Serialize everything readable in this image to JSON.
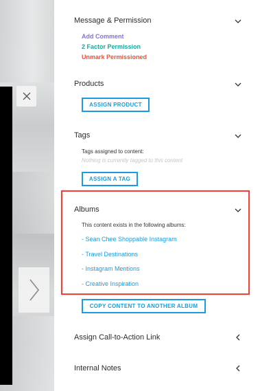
{
  "viewer": {
    "close_icon": "close-icon",
    "next_icon": "chevron-right-icon"
  },
  "sections": {
    "message_permission": {
      "title": "Message & Permission",
      "items": [
        {
          "label": "Add Comment",
          "color": "#8b6fe0"
        },
        {
          "label": "2 Factor Permission",
          "color": "#1ea79a"
        },
        {
          "label": "Unmark Permissioned",
          "color": "#e8563d"
        }
      ]
    },
    "products": {
      "title": "Products",
      "button": "ASSIGN PRODUCT"
    },
    "tags": {
      "title": "Tags",
      "caption": "Tags assigned to content:",
      "empty": "Nothing is currently tagged to this content",
      "button": "ASSIGN A TAG"
    },
    "albums": {
      "title": "Albums",
      "caption": "This content exists in the following albums:",
      "items": [
        "- Sean Chee Shoppable Instagram",
        "- Travel Destinations",
        "- Instagram Mentions",
        "- Creative Inspiration"
      ],
      "button": "COPY CONTENT TO ANOTHER ALBUM"
    },
    "cta": {
      "title": "Assign Call-to-Action Link"
    },
    "notes": {
      "title": "Internal Notes"
    }
  },
  "colors": {
    "accent": "#1a9ae0",
    "highlight": "#e8463a"
  }
}
